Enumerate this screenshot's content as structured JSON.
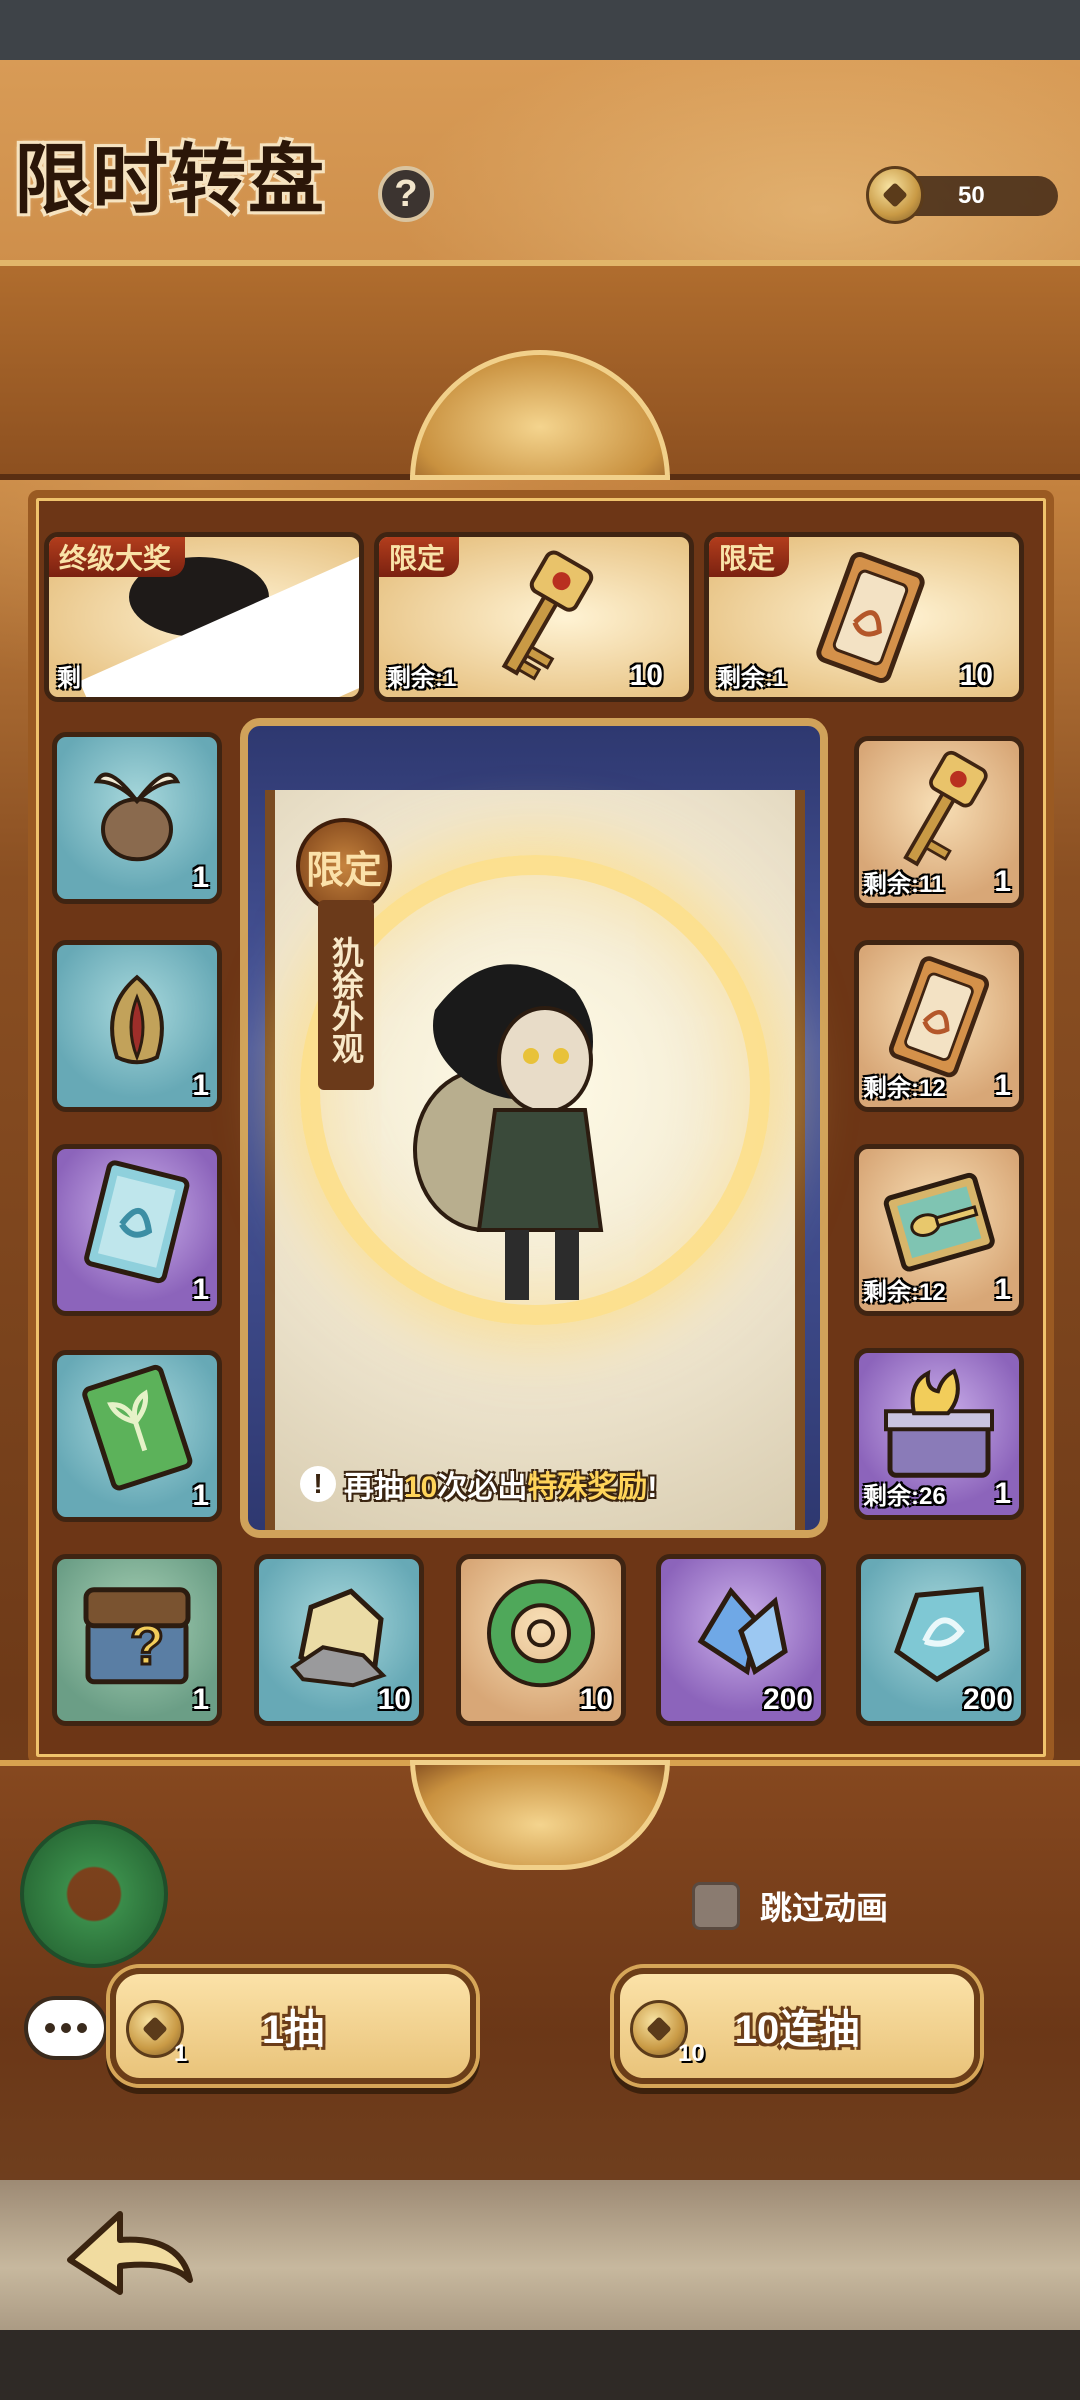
{
  "header": {
    "title": "限时转盘",
    "help_icon": "question-mark-icon",
    "coin_balance": "50"
  },
  "top_prizes": [
    {
      "tag": "终级大奖",
      "remaining": "剩",
      "quantity": ""
    },
    {
      "tag": "限定",
      "remaining": "剩余:1",
      "quantity": "10",
      "icon": "golden-key-icon"
    },
    {
      "tag": "限定",
      "remaining": "剩余:1",
      "quantity": "10",
      "icon": "talisman-ticket-icon"
    }
  ],
  "left_column": [
    {
      "quantity": "1",
      "icon": "seed-bulb-icon"
    },
    {
      "quantity": "1",
      "icon": "flower-bud-icon"
    },
    {
      "quantity": "1",
      "icon": "blue-scroll-icon"
    },
    {
      "quantity": "1",
      "icon": "green-scroll-icon"
    }
  ],
  "right_column": [
    {
      "remaining": "剩余:11",
      "quantity": "1",
      "icon": "golden-key-icon"
    },
    {
      "remaining": "剩余:12",
      "quantity": "1",
      "icon": "talisman-ticket-icon"
    },
    {
      "remaining": "剩余:12",
      "quantity": "1",
      "icon": "spoon-tablet-icon"
    },
    {
      "remaining": "剩余:26",
      "quantity": "1",
      "icon": "flame-chest-icon"
    }
  ],
  "bottom_row": [
    {
      "quantity": "1",
      "icon": "mystery-chest-icon"
    },
    {
      "quantity": "10",
      "icon": "ore-stone-icon"
    },
    {
      "quantity": "10",
      "icon": "jade-dragon-icon"
    },
    {
      "quantity": "200",
      "icon": "blue-crystal-icon"
    },
    {
      "quantity": "200",
      "icon": "spirit-gem-icon"
    }
  ],
  "featured": {
    "badge": "限定",
    "name": "犰狳外观",
    "notice_prefix": "再抽",
    "notice_count": "10",
    "notice_mid": "次必出",
    "notice_highlight": "特殊奖励",
    "notice_suffix": "!"
  },
  "controls": {
    "skip_label": "跳过动画",
    "single_draw_label": "1抽",
    "single_draw_cost": "1",
    "ten_draw_label": "10连抽",
    "ten_draw_cost": "10"
  },
  "colors": {
    "accent_gold": "#f0c36c",
    "frame_brown": "#6d3616",
    "highlight_yellow": "#ffd45a"
  }
}
